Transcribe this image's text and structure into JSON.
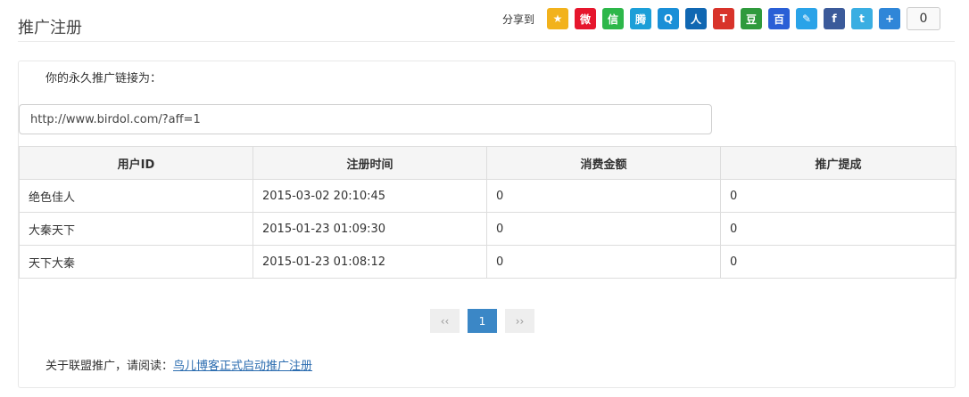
{
  "header": {
    "title": "推广注册"
  },
  "share": {
    "label": "分享到",
    "count": "0",
    "icons": [
      {
        "name": "qzone-icon",
        "color": "#f2b21c",
        "glyph": "★"
      },
      {
        "name": "weibo-icon",
        "color": "#e6162d",
        "glyph": "微"
      },
      {
        "name": "wechat-icon",
        "color": "#2db74a",
        "glyph": "信"
      },
      {
        "name": "tencent-weibo-icon",
        "color": "#1c9fd8",
        "glyph": "腾"
      },
      {
        "name": "qq-icon",
        "color": "#1a8fd7",
        "glyph": "Q"
      },
      {
        "name": "renren-icon",
        "color": "#1067b2",
        "glyph": "人"
      },
      {
        "name": "tianya-icon",
        "color": "#d8332a",
        "glyph": "T"
      },
      {
        "name": "douban-icon",
        "color": "#2f9a3d",
        "glyph": "豆"
      },
      {
        "name": "baidu-icon",
        "color": "#2a5fd6",
        "glyph": "百"
      },
      {
        "name": "note-icon",
        "color": "#2aa3e8",
        "glyph": "✎"
      },
      {
        "name": "facebook-icon",
        "color": "#3b5a9a",
        "glyph": "f"
      },
      {
        "name": "twitter-icon",
        "color": "#3aaee2",
        "glyph": "t"
      },
      {
        "name": "more-plus-icon",
        "color": "#2f86d8",
        "glyph": "+"
      }
    ]
  },
  "intro": "你的永久推广链接为：",
  "link": "http://www.birdol.com/?aff=1",
  "table": {
    "headers": [
      "用户ID",
      "注册时间",
      "消费金额",
      "推广提成"
    ],
    "rows": [
      [
        "绝色佳人",
        "2015-03-02 20:10:45",
        "0",
        "0"
      ],
      [
        "大秦天下",
        "2015-01-23 01:09:30",
        "0",
        "0"
      ],
      [
        "天下大秦",
        "2015-01-23 01:08:12",
        "0",
        "0"
      ]
    ]
  },
  "pagination": {
    "prev": "‹‹",
    "current": "1",
    "next": "››"
  },
  "footer": {
    "text": "关于联盟推广，请阅读：",
    "link_text": "鸟儿博客正式启动推广注册"
  }
}
